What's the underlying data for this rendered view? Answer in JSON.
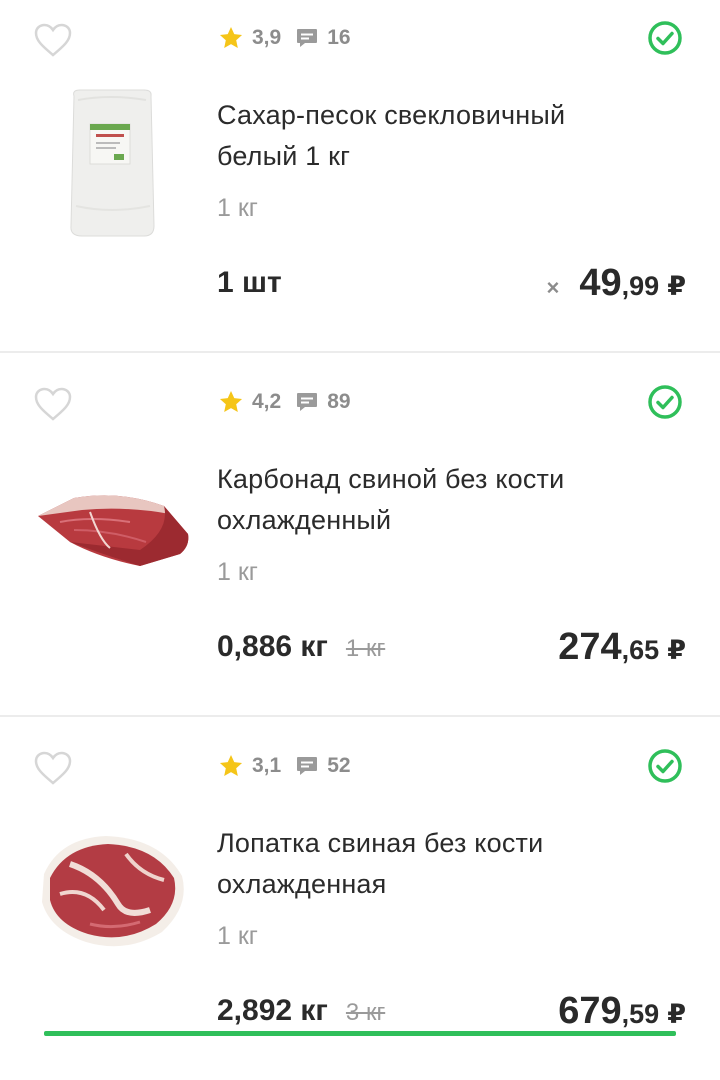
{
  "cart": {
    "items": [
      {
        "rating": "3,9",
        "reviews": "16",
        "title_line1": "Сахар-песок свекловичный",
        "title_line2": "белый 1 кг",
        "unit": "1 кг",
        "quantity": "1 шт",
        "old_quantity": "",
        "times_sign": "×",
        "price_int": "49",
        "price_dec": ",99",
        "currency": "₽",
        "image": "sugar-bag"
      },
      {
        "rating": "4,2",
        "reviews": "89",
        "title_line1": "Карбонад свиной без кости",
        "title_line2": "охлажденный",
        "unit": "1 кг",
        "quantity": "0,886 кг",
        "old_quantity": "1 кг",
        "times_sign": "",
        "price_int": "274",
        "price_dec": ",65",
        "currency": "₽",
        "image": "pork-loin"
      },
      {
        "rating": "3,1",
        "reviews": "52",
        "title_line1": "Лопатка свиная без кости",
        "title_line2": "охлажденная",
        "unit": "1 кг",
        "quantity": "2,892 кг",
        "old_quantity": "3 кг",
        "times_sign": "",
        "price_int": "679",
        "price_dec": ",59",
        "currency": "₽",
        "image": "pork-shoulder"
      }
    ]
  },
  "colors": {
    "accent_green": "#2fbf5a",
    "star": "#f5c518",
    "muted": "#9a9a9a"
  },
  "icons": {
    "favorite": "heart-outline-icon",
    "rating": "star-icon",
    "reviews": "comment-icon",
    "in_stock": "check-circle-icon"
  }
}
